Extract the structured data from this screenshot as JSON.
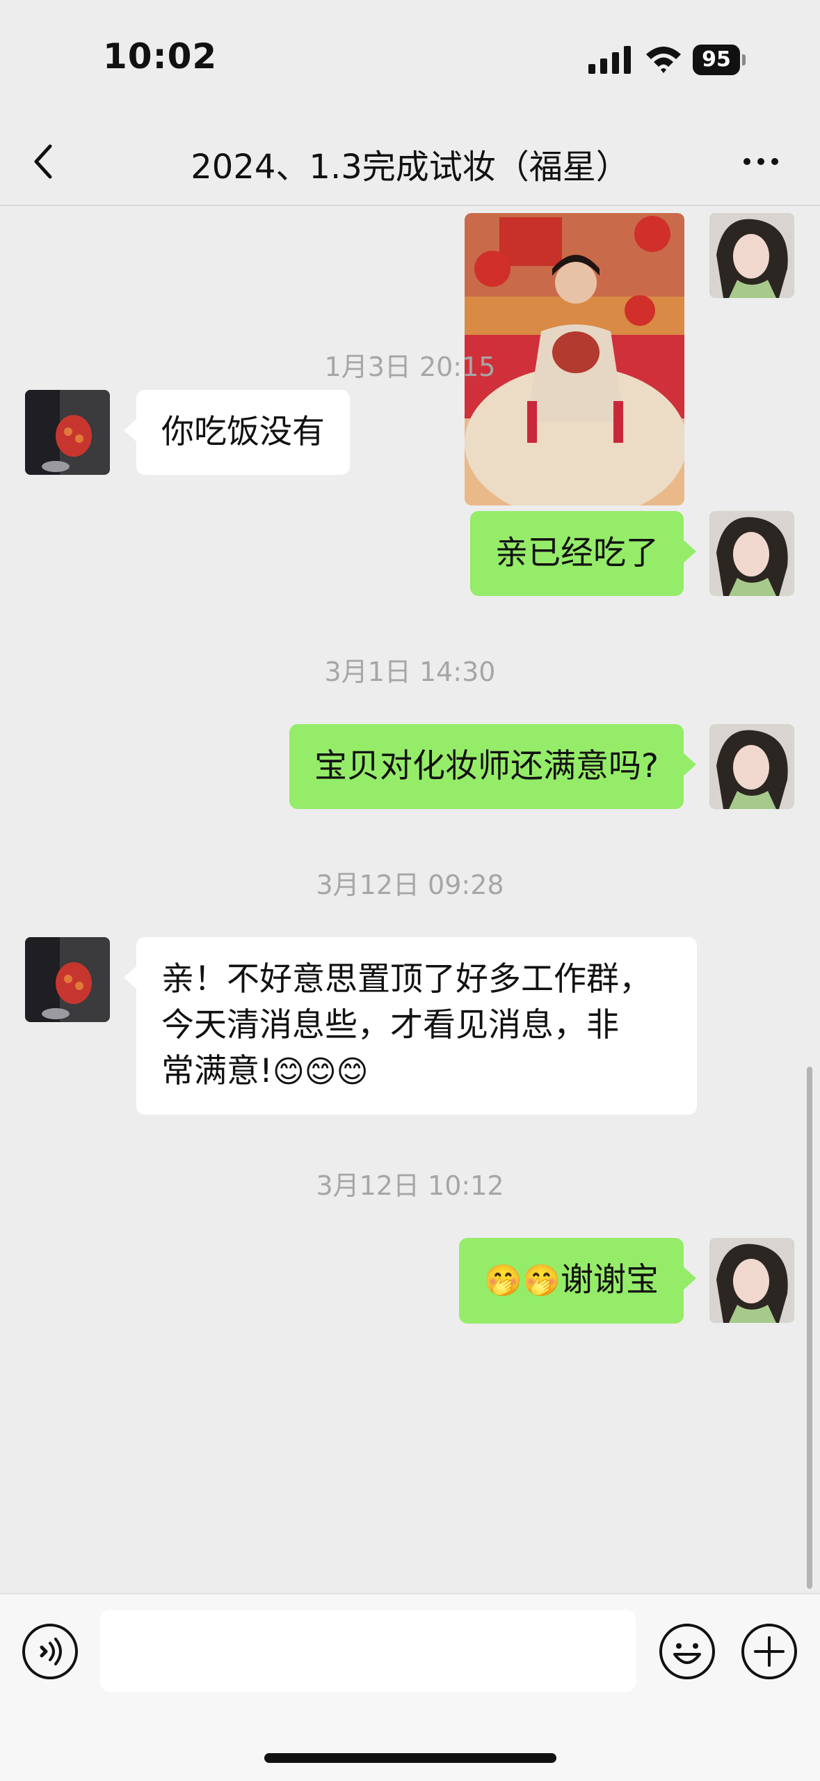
{
  "status_bar": {
    "time": "10:02",
    "battery": "95"
  },
  "nav": {
    "title": "2024、1.3完成试妆（福星）"
  },
  "messages": {
    "ts1": "1月3日 20:15",
    "m1": "你吃饭没有",
    "m2": "亲已经吃了",
    "ts2": "3月1日 14:30",
    "m3": "宝贝对化妆师还满意吗?",
    "ts3": "3月12日 09:28",
    "m4_line1": "亲！不好意思置顶了好多工作群，",
    "m4_line2": "今天清消息些，才看见消息，非",
    "m4_line3": "常满意!",
    "m4_emoji": "😊😊😊",
    "ts4": "3月12日 10:12",
    "m5_emoji": "🤭🤭",
    "m5_text": "谢谢宝"
  },
  "icons": {
    "back": "chevron-left-icon",
    "more": "more-icon",
    "voice": "voice-icon",
    "emoji": "emoji-icon",
    "plus": "plus-icon"
  },
  "colors": {
    "bubble_me": "#95ec69",
    "bubble_other": "#ffffff",
    "background": "#ededed"
  }
}
